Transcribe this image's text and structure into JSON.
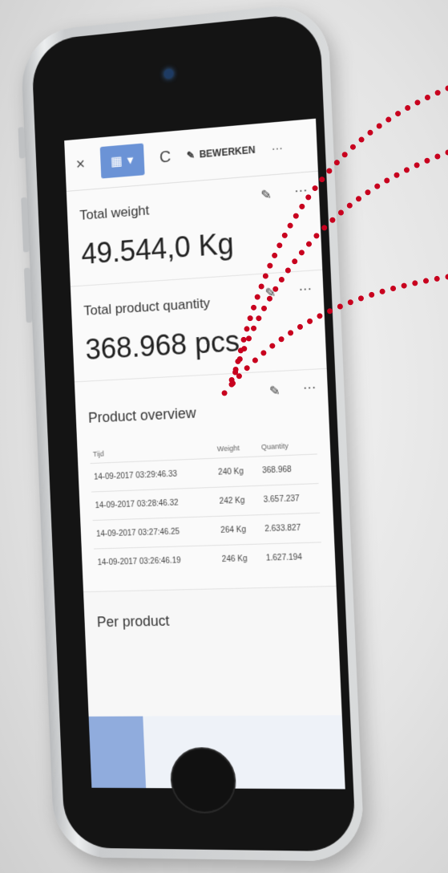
{
  "toolbar": {
    "close_icon": "×",
    "calendar_icon": "▦",
    "refresh_icon": "C",
    "edit_label": "BEWERKEN",
    "more_icon": "···"
  },
  "cards": [
    {
      "label": "Total weight",
      "value": "49.544,0 Kg"
    },
    {
      "label": "Total product quantity",
      "value": "368.968 pcs"
    }
  ],
  "overview": {
    "title": "Product overview",
    "headers": [
      "Tijd",
      "Weight",
      "Quantity"
    ],
    "rows": [
      [
        "14-09-2017 03:29:46.33",
        "240 Kg",
        "368.968"
      ],
      [
        "14-09-2017 03:28:46.32",
        "242 Kg",
        "3.657.237"
      ],
      [
        "14-09-2017 03:27:46.25",
        "264 Kg",
        "2.633.827"
      ],
      [
        "14-09-2017 03:26:46.19",
        "246 Kg",
        "1.627.194"
      ]
    ]
  },
  "per_product": {
    "title": "Per product"
  },
  "colors": {
    "accent": "#6b93d6",
    "annotation": "#c8001e"
  }
}
